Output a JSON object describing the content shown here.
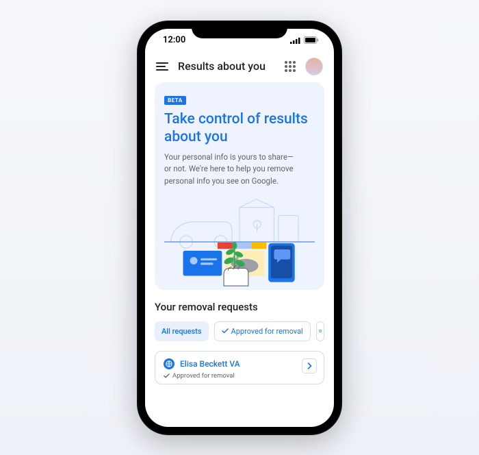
{
  "status": {
    "time": "12:00"
  },
  "header": {
    "title": "Results about you"
  },
  "hero": {
    "badge": "BETA",
    "title": "Take control of results about you",
    "body": "Your personal info is yours to share—\nor not. We're here to help you remove\npersonal info you see on Google."
  },
  "section": {
    "title": "Your removal requests"
  },
  "chips": {
    "all": "All requests",
    "approved": "Approved for removal"
  },
  "request": {
    "name": "Elisa Beckett VA",
    "status": "Approved for removal"
  }
}
